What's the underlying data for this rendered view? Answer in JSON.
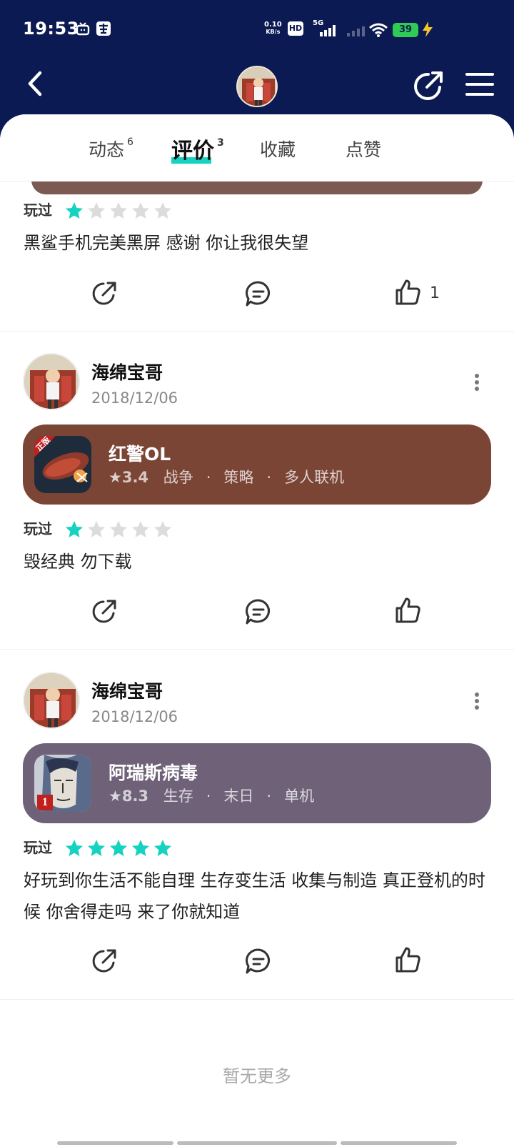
{
  "status_bar": {
    "time": "19:53",
    "net_speed_value": "0.10",
    "net_speed_unit": "KB/s",
    "hd_label": "HD",
    "network": "5G",
    "battery": "39"
  },
  "tabs": [
    {
      "label": "动态",
      "count": "6"
    },
    {
      "label": "评价",
      "count": "3"
    },
    {
      "label": "收藏",
      "count": ""
    },
    {
      "label": "点赞",
      "count": ""
    }
  ],
  "colors": {
    "header_bg": "#0b1a52",
    "accent": "#16d2c0",
    "star_empty": "#dcdcdc"
  },
  "reviews": [
    {
      "played_label": "玩过",
      "rating": 1,
      "text": "黑鲨手机完美黑屏 感谢 你让我很失望",
      "like_count": "1"
    },
    {
      "user": "海绵宝哥",
      "date": "2018/12/06",
      "game": {
        "name": "红警OL",
        "score": "3.4",
        "tags": [
          "战争",
          "策略",
          "多人联机"
        ],
        "badge": "正版",
        "color": "#7b4536"
      },
      "played_label": "玩过",
      "rating": 1,
      "text": "毁经典 勿下载",
      "like_count": ""
    },
    {
      "user": "海绵宝哥",
      "date": "2018/12/06",
      "game": {
        "name": "阿瑞斯病毒",
        "score": "8.3",
        "tags": [
          "生存",
          "末日",
          "单机"
        ],
        "badge": "1",
        "color": "#6e6178"
      },
      "played_label": "玩过",
      "rating": 5,
      "text": "好玩到你生活不能自理 生存变生活 收集与制造 真正登机的时候 你舍得走吗 来了你就知道",
      "like_count": ""
    }
  ],
  "footer": {
    "no_more": "暂无更多"
  }
}
